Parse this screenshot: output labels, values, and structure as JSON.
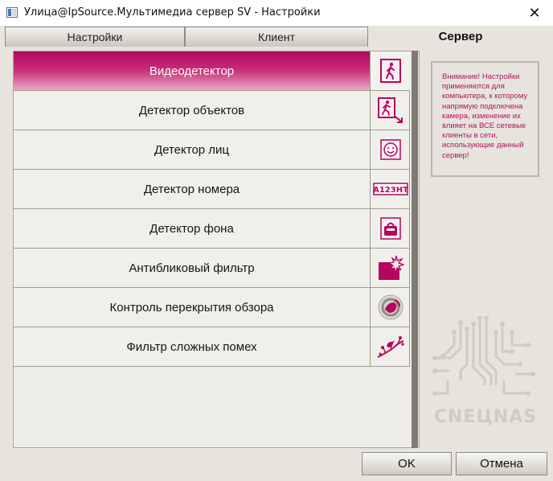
{
  "window": {
    "title": "Улица@IpSource.Мультимедиа сервер SV - Настройки",
    "close_glyph": "✕"
  },
  "tabs": [
    {
      "label": "Настройки",
      "active": false
    },
    {
      "label": "Клиент",
      "active": false
    },
    {
      "label": "Сервер",
      "active": true
    }
  ],
  "detectors": [
    {
      "label": "Видеодетектор",
      "icon": "walking-person-icon",
      "selected": true
    },
    {
      "label": "Детектор объектов",
      "icon": "person-object-icon",
      "selected": false
    },
    {
      "label": "Детектор лиц",
      "icon": "face-icon",
      "selected": false
    },
    {
      "label": "Детектор номера",
      "icon": "license-plate-icon",
      "icon_text": "A123HT",
      "selected": false
    },
    {
      "label": "Детектор фона",
      "icon": "bag-icon",
      "selected": false
    },
    {
      "label": "Антибликовый фильтр",
      "icon": "glare-filter-icon",
      "selected": false
    },
    {
      "label": "Контроль перекрытия обзора",
      "icon": "view-blocked-icon",
      "selected": false
    },
    {
      "label": "Фильтр сложных помех",
      "icon": "bird-branch-icon",
      "selected": false
    }
  ],
  "notice": {
    "text": "Внимание! Настройки применяются для компьютера, к которому напрямую подключена камера, изменение их влияет на ВСЕ сетевые клиенты в сети, использующие данный сервер!"
  },
  "logo": {
    "text": "CNEЦNAS"
  },
  "buttons": {
    "ok": "OK",
    "cancel": "Отмена"
  },
  "colors": {
    "accent": "#b3065e",
    "notice_text": "#b0135f",
    "background": "#e6e4dd"
  }
}
